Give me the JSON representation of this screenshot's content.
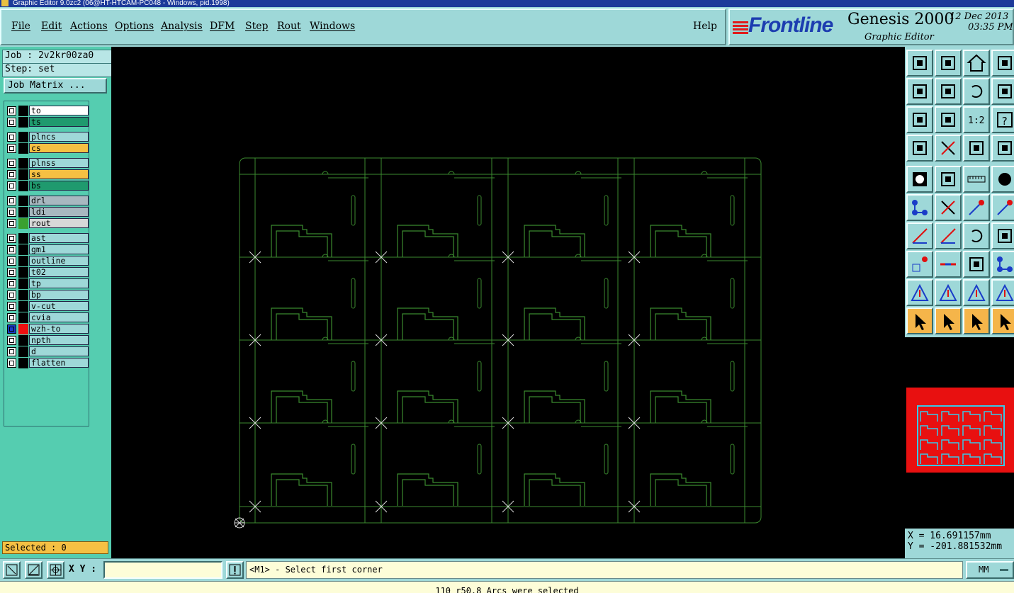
{
  "window": {
    "title": "Graphic Editor 9.0zc2 (06@HT-HTCAM-PC048 - Windows, pid.1998)"
  },
  "menu": {
    "items": [
      "File",
      "Edit",
      "Actions",
      "Options",
      "Analysis",
      "DFM",
      "Step",
      "Rout",
      "Windows"
    ],
    "help": "Help"
  },
  "logo": {
    "brand": "Frontline",
    "product": "Genesis 2000",
    "subtitle": "Graphic Editor",
    "date": "12 Dec 2013",
    "time": "03:35 PM"
  },
  "job": {
    "job_label": "Job : 2v2kr00za0",
    "step_label": "Step: set",
    "matrix_button": "Job Matrix ..."
  },
  "layers": [
    {
      "name": "to",
      "color": "#ffffff"
    },
    {
      "name": "ts",
      "color": "#1f9a6e"
    },
    {
      "name": "plncs",
      "color": "#9ed8d8"
    },
    {
      "name": "cs",
      "color": "#f5c043"
    },
    {
      "name": "plnss",
      "color": "#9ed8d8"
    },
    {
      "name": "ss",
      "color": "#f5c043"
    },
    {
      "name": "bs",
      "color": "#1f9a6e"
    },
    {
      "name": "drl",
      "color": "#a8b8c0"
    },
    {
      "name": "ldi",
      "color": "#a8b8c0"
    },
    {
      "name": "rout",
      "color": "#d8d8d8",
      "marker": "#3aa030"
    },
    {
      "name": "ast",
      "color": "#9ed8d8"
    },
    {
      "name": "gm1",
      "color": "#9ed8d8"
    },
    {
      "name": "outline",
      "color": "#9ed8d8"
    },
    {
      "name": "t02",
      "color": "#9ed8d8"
    },
    {
      "name": "tp",
      "color": "#9ed8d8"
    },
    {
      "name": "bp",
      "color": "#9ed8d8"
    },
    {
      "name": "v-cut",
      "color": "#9ed8d8"
    },
    {
      "name": "cvia",
      "color": "#9ed8d8"
    },
    {
      "name": "wzh-to",
      "color": "#9ed8d8",
      "marker": "#ee1010",
      "work": true
    },
    {
      "name": "npth",
      "color": "#9ed8d8"
    },
    {
      "name": "d",
      "color": "#9ed8d8"
    },
    {
      "name": "flatten",
      "color": "#9ed8d8"
    }
  ],
  "selection": {
    "label": "Selected : 0"
  },
  "toolbar": {
    "icons": [
      "step-up-icon",
      "step-down-icon",
      "home-icon",
      "window-icon",
      "pan-left-icon",
      "pan-right-icon",
      "undo-icon",
      "redo-icon",
      "fit-icon",
      "zoom-icon",
      "one-to-two-icon",
      "help-icon",
      "measure-tool-icon",
      "cut-icon",
      "snap-icon",
      "snap2-icon",
      "pad-icon",
      "line-icon",
      "ruler-icon",
      "circle-icon",
      "net-icon",
      "cross-icon",
      "arrow-icon",
      "arrow2-icon",
      "slope-icon",
      "slope2-icon",
      "arc-icon",
      "flip-icon",
      "point-icon",
      "dash-icon",
      "box-icon",
      "cluster-icon",
      "triangle-icon",
      "triangle2-icon",
      "triangle3-icon",
      "triangle4-icon",
      "pointer-icon",
      "pointer-box-icon",
      "pointer-circle-icon",
      "pointer-net-icon"
    ]
  },
  "coords": {
    "x": "X =  16.691157mm",
    "y": "Y = -201.881532mm"
  },
  "bottom": {
    "xy_label": "X Y :",
    "xy_value": "",
    "prompt": "<M1> - Select first corner",
    "units": "MM",
    "status": "110 r50.8 Arcs were selected"
  },
  "colors": {
    "panel": "#9ed8d8",
    "left_panel": "#55cdb0",
    "canvas": "#000000",
    "board_line": "#3b8a2f",
    "brand_blue": "#1c3cb0",
    "highlight": "#f5c043"
  }
}
